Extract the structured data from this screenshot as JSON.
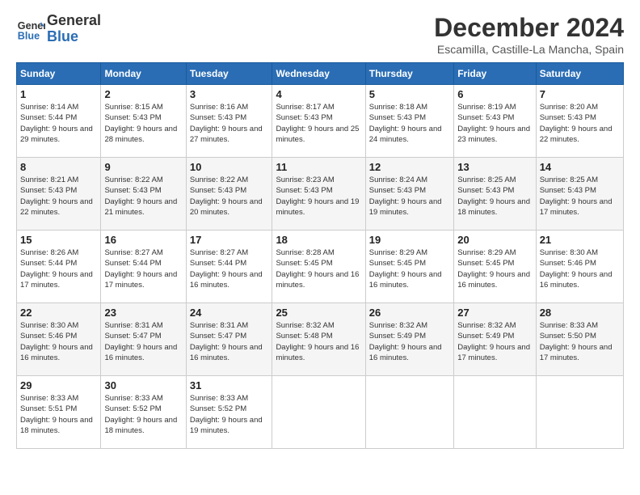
{
  "header": {
    "logo_line1": "General",
    "logo_line2": "Blue",
    "month": "December 2024",
    "location": "Escamilla, Castille-La Mancha, Spain"
  },
  "weekdays": [
    "Sunday",
    "Monday",
    "Tuesday",
    "Wednesday",
    "Thursday",
    "Friday",
    "Saturday"
  ],
  "weeks": [
    [
      {
        "day": "1",
        "sunrise": "8:14 AM",
        "sunset": "5:44 PM",
        "daylight": "9 hours and 29 minutes."
      },
      {
        "day": "2",
        "sunrise": "8:15 AM",
        "sunset": "5:43 PM",
        "daylight": "9 hours and 28 minutes."
      },
      {
        "day": "3",
        "sunrise": "8:16 AM",
        "sunset": "5:43 PM",
        "daylight": "9 hours and 27 minutes."
      },
      {
        "day": "4",
        "sunrise": "8:17 AM",
        "sunset": "5:43 PM",
        "daylight": "9 hours and 25 minutes."
      },
      {
        "day": "5",
        "sunrise": "8:18 AM",
        "sunset": "5:43 PM",
        "daylight": "9 hours and 24 minutes."
      },
      {
        "day": "6",
        "sunrise": "8:19 AM",
        "sunset": "5:43 PM",
        "daylight": "9 hours and 23 minutes."
      },
      {
        "day": "7",
        "sunrise": "8:20 AM",
        "sunset": "5:43 PM",
        "daylight": "9 hours and 22 minutes."
      }
    ],
    [
      {
        "day": "8",
        "sunrise": "8:21 AM",
        "sunset": "5:43 PM",
        "daylight": "9 hours and 22 minutes."
      },
      {
        "day": "9",
        "sunrise": "8:22 AM",
        "sunset": "5:43 PM",
        "daylight": "9 hours and 21 minutes."
      },
      {
        "day": "10",
        "sunrise": "8:22 AM",
        "sunset": "5:43 PM",
        "daylight": "9 hours and 20 minutes."
      },
      {
        "day": "11",
        "sunrise": "8:23 AM",
        "sunset": "5:43 PM",
        "daylight": "9 hours and 19 minutes."
      },
      {
        "day": "12",
        "sunrise": "8:24 AM",
        "sunset": "5:43 PM",
        "daylight": "9 hours and 19 minutes."
      },
      {
        "day": "13",
        "sunrise": "8:25 AM",
        "sunset": "5:43 PM",
        "daylight": "9 hours and 18 minutes."
      },
      {
        "day": "14",
        "sunrise": "8:25 AM",
        "sunset": "5:43 PM",
        "daylight": "9 hours and 17 minutes."
      }
    ],
    [
      {
        "day": "15",
        "sunrise": "8:26 AM",
        "sunset": "5:44 PM",
        "daylight": "9 hours and 17 minutes."
      },
      {
        "day": "16",
        "sunrise": "8:27 AM",
        "sunset": "5:44 PM",
        "daylight": "9 hours and 17 minutes."
      },
      {
        "day": "17",
        "sunrise": "8:27 AM",
        "sunset": "5:44 PM",
        "daylight": "9 hours and 16 minutes."
      },
      {
        "day": "18",
        "sunrise": "8:28 AM",
        "sunset": "5:45 PM",
        "daylight": "9 hours and 16 minutes."
      },
      {
        "day": "19",
        "sunrise": "8:29 AM",
        "sunset": "5:45 PM",
        "daylight": "9 hours and 16 minutes."
      },
      {
        "day": "20",
        "sunrise": "8:29 AM",
        "sunset": "5:45 PM",
        "daylight": "9 hours and 16 minutes."
      },
      {
        "day": "21",
        "sunrise": "8:30 AM",
        "sunset": "5:46 PM",
        "daylight": "9 hours and 16 minutes."
      }
    ],
    [
      {
        "day": "22",
        "sunrise": "8:30 AM",
        "sunset": "5:46 PM",
        "daylight": "9 hours and 16 minutes."
      },
      {
        "day": "23",
        "sunrise": "8:31 AM",
        "sunset": "5:47 PM",
        "daylight": "9 hours and 16 minutes."
      },
      {
        "day": "24",
        "sunrise": "8:31 AM",
        "sunset": "5:47 PM",
        "daylight": "9 hours and 16 minutes."
      },
      {
        "day": "25",
        "sunrise": "8:32 AM",
        "sunset": "5:48 PM",
        "daylight": "9 hours and 16 minutes."
      },
      {
        "day": "26",
        "sunrise": "8:32 AM",
        "sunset": "5:49 PM",
        "daylight": "9 hours and 16 minutes."
      },
      {
        "day": "27",
        "sunrise": "8:32 AM",
        "sunset": "5:49 PM",
        "daylight": "9 hours and 17 minutes."
      },
      {
        "day": "28",
        "sunrise": "8:33 AM",
        "sunset": "5:50 PM",
        "daylight": "9 hours and 17 minutes."
      }
    ],
    [
      {
        "day": "29",
        "sunrise": "8:33 AM",
        "sunset": "5:51 PM",
        "daylight": "9 hours and 18 minutes."
      },
      {
        "day": "30",
        "sunrise": "8:33 AM",
        "sunset": "5:52 PM",
        "daylight": "9 hours and 18 minutes."
      },
      {
        "day": "31",
        "sunrise": "8:33 AM",
        "sunset": "5:52 PM",
        "daylight": "9 hours and 19 minutes."
      },
      null,
      null,
      null,
      null
    ]
  ]
}
